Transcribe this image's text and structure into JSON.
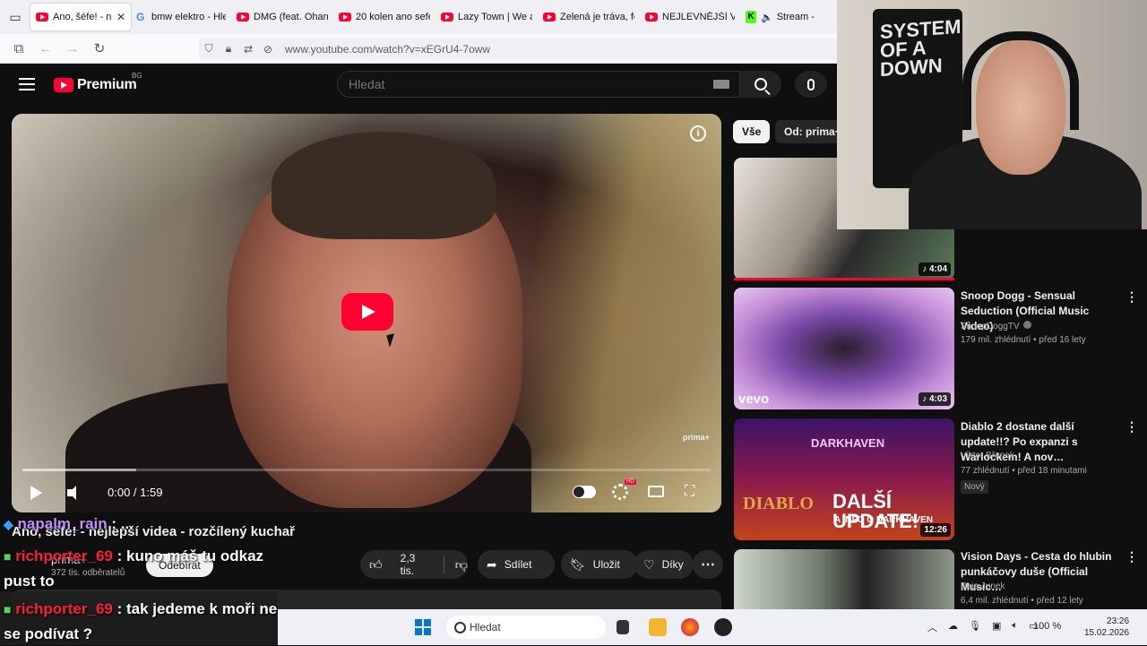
{
  "browser": {
    "tabs": [
      {
        "label": "Ano, šéfe! - nej",
        "favicon": "youtube-icon",
        "active": true
      },
      {
        "label": "bmw elektro - Hle",
        "favicon": "google-icon"
      },
      {
        "label": "DMG (feat. Ohan",
        "favicon": "youtube-icon"
      },
      {
        "label": "20 kolen ano sefe",
        "favicon": "youtube-icon"
      },
      {
        "label": "Lazy Town | We ar",
        "favicon": "youtube-icon"
      },
      {
        "label": "Zelená je tráva, fo",
        "favicon": "youtube-icon"
      },
      {
        "label": "NEJLEVNĚJŠÍ VS. N",
        "favicon": "youtube-icon"
      },
      {
        "label": "Stream - Ki",
        "favicon": "kick-icon"
      }
    ],
    "close_glyph": "✕",
    "url": "www.youtube.com/watch?v=xEGrU4-7oww"
  },
  "masthead": {
    "logo_word": "Premium",
    "country_code": "BG",
    "search_placeholder": "Hledat"
  },
  "player": {
    "time": "0:00 / 1:59",
    "watermark": "prima+",
    "info_glyph": "i",
    "hd_badge": "HD",
    "progress_loaded": 0.166
  },
  "video": {
    "title": "Ano, šéfe! - nejlepší videa - rozčílený kuchař",
    "channel": "prima+",
    "subscribers": "372 tis. odběratelů",
    "subscribe_label": "Odebírat",
    "likes": "2,3 tis.",
    "share_label": "Sdílet",
    "save_label": "Uložit",
    "thanks_label": "Díky"
  },
  "chat": [
    {
      "user": "napalm_rain",
      "message": ": ..."
    },
    {
      "user": "richporter_69",
      "message": ": kuno máš tu odkaz pust to"
    },
    {
      "user": "richporter_69",
      "message": ": tak jedeme k moři ne se podívat ?"
    }
  ],
  "chips": {
    "all": "Vše",
    "from": "Od: prima+"
  },
  "recommendations": [
    {
      "title": "",
      "duration": "4:04",
      "channel": "",
      "meta": ""
    },
    {
      "title": "Snoop Dogg - Sensual Seduction (Official Music Video)",
      "duration": "4:03",
      "channel": "SnoopDoggTV",
      "meta": "179 mil. zhlédnutí • před 16 lety",
      "verified": true
    },
    {
      "title": "Diablo 2 dostane další update!!? Po expanzi s Warlockem! A nov…",
      "duration": "12:26",
      "channel": "Viktor Břenek",
      "meta": "77 zhlédnutí • před 18 minutami",
      "badge": "Nový",
      "thumb_text": "DALŠÍ UPDATE!",
      "thumb_sub": "A INFO O DARKHAVEN",
      "thumb_brand": "DARKHAVEN",
      "thumb_logo": "DIABLO"
    },
    {
      "title": "Vision Days - Cesta do hlubin punkáčovy duše (Official Music…",
      "duration": "",
      "channel": "Paja Junek",
      "meta": "6,4 mil. zhlédnutí • před 12 lety"
    }
  ],
  "webcam": {
    "shirt_text": "SYSTEM OF A DOWN"
  },
  "taskbar": {
    "search_label": "Hledat",
    "battery": "100 %",
    "time": "23:26",
    "date": "15.02.2026"
  },
  "colors": {
    "youtube_red": "#ff0033",
    "background": "#0f0f0f",
    "chat_user": "#ff1f3a",
    "chat_user_alt": "#c48cff"
  }
}
